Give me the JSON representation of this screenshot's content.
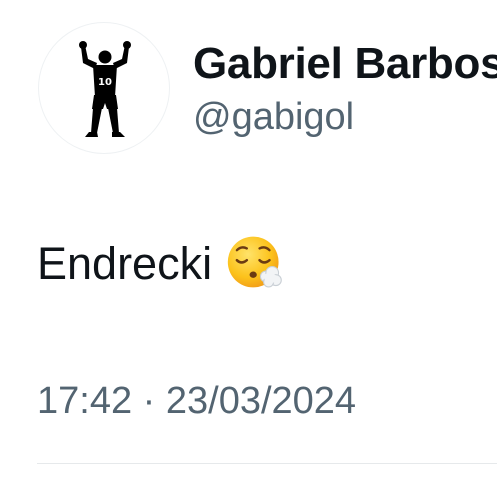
{
  "author": {
    "display_name": "Gabriel Barbosa",
    "handle": "@gabigol",
    "avatar_jersey_number": "10",
    "avatar_icon": "player-silhouette-icon"
  },
  "tweet": {
    "text": "Endrecki",
    "emoji_icon": "face-exhaling-emoji",
    "time": "17:42",
    "separator": "·",
    "date": "23/03/2024"
  },
  "colors": {
    "primary_text": "#0f1419",
    "secondary_text": "#536471",
    "divider": "#e6e9eb"
  }
}
